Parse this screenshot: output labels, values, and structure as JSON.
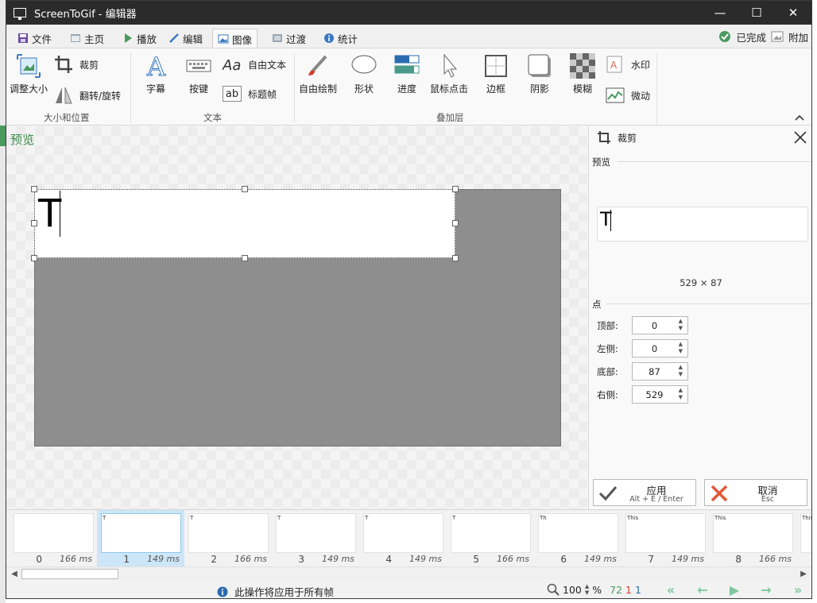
{
  "window": {
    "title": "ScreenToGif - 编辑器"
  },
  "tabs": [
    {
      "label": "文件"
    },
    {
      "label": "主页"
    },
    {
      "label": "播放"
    },
    {
      "label": "编辑"
    },
    {
      "label": "图像"
    },
    {
      "label": "过渡"
    },
    {
      "label": "统计"
    }
  ],
  "status_right": {
    "done": "已完成",
    "extras": "附加"
  },
  "ribbon": {
    "resize": "调整大小",
    "crop": "裁剪",
    "flip": "翻转/旋转",
    "group_size": "大小和位置",
    "caption": "字幕",
    "keystrokes": "按键",
    "free_text": "自由文本",
    "title_frame": "标题帧",
    "group_text": "文本",
    "free_drawing": "自由绘制",
    "shapes": "形状",
    "progress": "进度",
    "mouse_clicks": "鼠标点击",
    "border": "边框",
    "shadow": "阴影",
    "obfuscate": "模糊",
    "watermark": "水印",
    "cinemagraph": "微动",
    "group_overlay": "叠加层",
    "ab_label": "ab"
  },
  "canvas": {
    "preview_label": "预览",
    "frame_text": "T"
  },
  "side_panel": {
    "title": "裁剪",
    "preview_title": "预览",
    "preview_text": "T",
    "dimensions": "529 × 87",
    "points_title": "点",
    "fields": [
      {
        "label": "顶部:",
        "value": "0"
      },
      {
        "label": "左侧:",
        "value": "0"
      },
      {
        "label": "底部:",
        "value": "87"
      },
      {
        "label": "右侧:",
        "value": "529"
      }
    ],
    "apply": {
      "label": "应用",
      "shortcut": "Alt + E / Enter"
    },
    "cancel": {
      "label": "取消",
      "shortcut": "Esc"
    }
  },
  "frames": [
    {
      "index": "0",
      "ms": "166 ms",
      "text": ""
    },
    {
      "index": "1",
      "ms": "149 ms",
      "text": "T"
    },
    {
      "index": "2",
      "ms": "166 ms",
      "text": "T"
    },
    {
      "index": "3",
      "ms": "149 ms",
      "text": "T"
    },
    {
      "index": "4",
      "ms": "149 ms",
      "text": "T"
    },
    {
      "index": "5",
      "ms": "166 ms",
      "text": "T"
    },
    {
      "index": "6",
      "ms": "149 ms",
      "text": "Th"
    },
    {
      "index": "7",
      "ms": "149 ms",
      "text": "This"
    },
    {
      "index": "8",
      "ms": "166 ms",
      "text": "This"
    },
    {
      "index": "",
      "ms": "",
      "text": "This"
    }
  ],
  "status": {
    "info": "此操作将应用于所有帧",
    "zoom": "100",
    "percent": "%",
    "count_total": "72",
    "count_selected": "1",
    "count_current": "1"
  },
  "colors": {
    "accent_green": "#3c8a4a",
    "selection_blue": "#cde6f7",
    "nav_green": "#7fc6a0"
  }
}
